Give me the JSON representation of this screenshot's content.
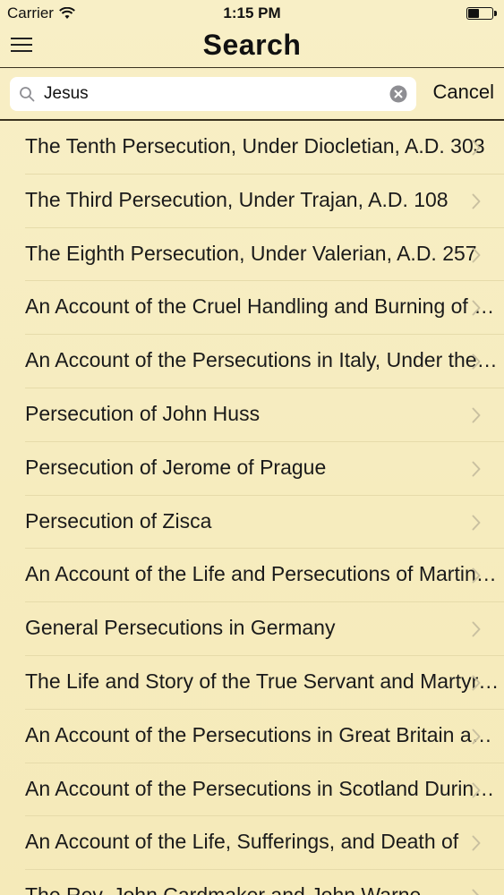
{
  "status_bar": {
    "carrier": "Carrier",
    "time": "1:15 PM"
  },
  "nav": {
    "title": "Search",
    "menu_icon": "hamburger-menu-icon"
  },
  "search": {
    "value": "Jesus",
    "cancel_label": "Cancel"
  },
  "results": [
    "The Tenth Persecution, Under Diocletian, A.D. 303",
    "The Third Persecution, Under Trajan, A.D. 108",
    "The Eighth Persecution, Under Valerian, A.D. 257",
    "An Account of the Cruel Handling and Burning of Nicholas Burton",
    "An Account of the Persecutions in Italy, Under the Papacy",
    "Persecution of John Huss",
    "Persecution of Jerome of Prague",
    "Persecution of Zisca",
    "An Account of the Life and Persecutions of Martin Luther",
    "General Persecutions in Germany",
    "The Life and Story of the True Servant and Martyr of God",
    "An Account of the Persecutions in Great Britain and Ireland",
    "An Account of the Persecutions in Scotland During the Reign",
    "An Account of the Life, Sufferings, and Death of",
    "The Rev. John Cardmaker and John Warne"
  ],
  "colors": {
    "background": "#f7eec2",
    "separator": "#e6dbaa",
    "chevron": "#c9c0a0"
  }
}
